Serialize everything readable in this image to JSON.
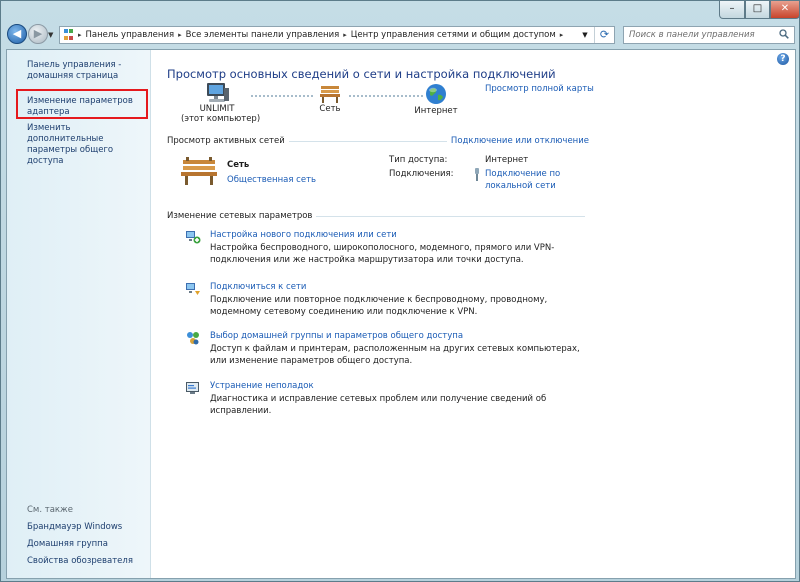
{
  "window": {
    "controls": {
      "minimize": "–",
      "maximize": "□",
      "close": "✕"
    }
  },
  "nav": {
    "back_icon": "arrow-left-icon",
    "forward_icon": "arrow-right-icon",
    "breadcrumbs": [
      "Панель управления",
      "Все элементы панели управления",
      "Центр управления сетями и общим доступом"
    ],
    "search_placeholder": "Поиск в панели управления"
  },
  "sidebar": {
    "home_link": "Панель управления - домашняя страница",
    "adapter_link": "Изменение параметров адаптера",
    "sharing_link": "Изменить дополнительные параметры общего доступа",
    "see_also_label": "См. также",
    "see_also": [
      "Брандмауэр Windows",
      "Домашняя группа",
      "Свойства обозревателя"
    ]
  },
  "main": {
    "title": "Просмотр основных сведений о сети и настройка подключений",
    "map_link": "Просмотр полной карты",
    "nodes": {
      "computer": {
        "name": "UNLIMIT",
        "sub": "(этот компьютер)"
      },
      "network": {
        "name": "Сеть"
      },
      "internet": {
        "name": "Интернет"
      }
    },
    "active": {
      "label": "Просмотр активных сетей",
      "connect_link": "Подключение или отключение",
      "network_name": "Сеть",
      "network_type": "Общественная сеть",
      "access_label": "Тип доступа:",
      "access_value": "Интернет",
      "connections_label": "Подключения:",
      "connections_value_1": "Подключение по",
      "connections_value_2": "локальной сети"
    },
    "change": {
      "label": "Изменение сетевых параметров",
      "tasks": [
        {
          "title": "Настройка нового подключения или сети",
          "desc": "Настройка беспроводного, широкополосного, модемного, прямого или VPN-подключения или же настройка маршрутизатора или точки доступа."
        },
        {
          "title": "Подключиться к сети",
          "desc": "Подключение или повторное подключение к беспроводному, проводному, модемному сетевому соединению или подключение к VPN."
        },
        {
          "title": "Выбор домашней группы и параметров общего доступа",
          "desc": "Доступ к файлам и принтерам, расположенным на других сетевых компьютерах, или изменение параметров общего доступа."
        },
        {
          "title": "Устранение неполадок",
          "desc": "Диагностика и исправление сетевых проблем или получение сведений об исправлении."
        }
      ]
    }
  }
}
